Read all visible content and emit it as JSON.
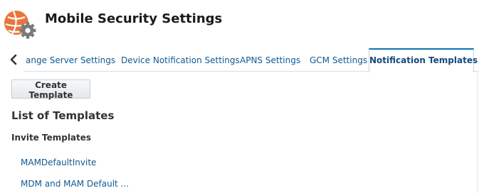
{
  "header": {
    "title": "Mobile Security Settings",
    "logo_icon": "mobile-security-gear-globe-icon",
    "logo_color": "#e8753d",
    "gear_color": "#7a7a7a"
  },
  "tabs": {
    "scroll_left_icon": "chevron-left-icon",
    "items": [
      {
        "label": "ange Server Settings",
        "active": false
      },
      {
        "label": "Device Notification Settings",
        "active": false
      },
      {
        "label": "APNS Settings",
        "active": false
      },
      {
        "label": "GCM Settings",
        "active": false
      },
      {
        "label": "Notification Templates",
        "active": true
      }
    ],
    "link_color": "#0e5a96",
    "active_accent": "#0b71b3"
  },
  "main": {
    "create_button_label": "Create Template",
    "list_title": "List of Templates",
    "invite_section_title": "Invite Templates",
    "invite_templates": [
      {
        "label": "MAMDefaultInvite"
      },
      {
        "label": "MDM and MAM Default ..."
      }
    ]
  }
}
